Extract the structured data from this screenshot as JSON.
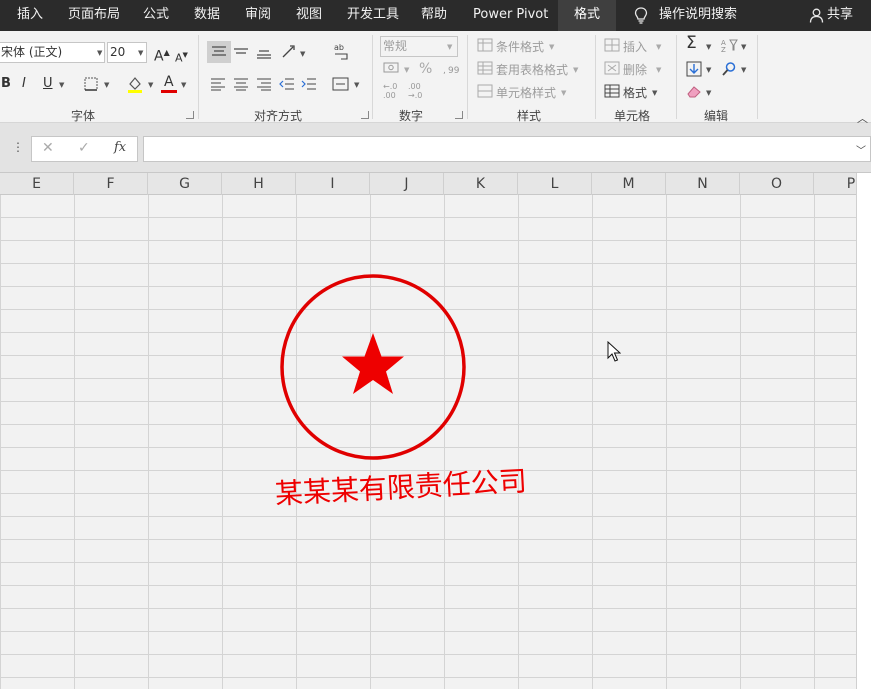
{
  "menu": {
    "tabs": [
      {
        "label": "插入"
      },
      {
        "label": "页面布局"
      },
      {
        "label": "公式"
      },
      {
        "label": "数据"
      },
      {
        "label": "审阅"
      },
      {
        "label": "视图"
      },
      {
        "label": "开发工具"
      },
      {
        "label": "帮助"
      },
      {
        "label": "Power Pivot"
      },
      {
        "label": "格式",
        "active": true
      }
    ],
    "tell_me": "操作说明搜索",
    "share": "共享"
  },
  "ribbon": {
    "font": {
      "group_label": "字体",
      "name": "宋体 (正文)",
      "size": "20",
      "grow": "A",
      "shrink": "A",
      "bold": "B",
      "italic": "I",
      "underline": "U",
      "font_color_letter": "A"
    },
    "alignment": {
      "group_label": "对齐方式"
    },
    "number": {
      "group_label": "数字",
      "format": "常规",
      "percent": "%",
      "inc_top": "←.0",
      "inc_bottom": ".00",
      "dec_top": ".00",
      "dec_bottom": "→.0"
    },
    "styles": {
      "group_label": "样式",
      "conditional": "条件格式",
      "table": "套用表格格式",
      "cell": "单元格样式"
    },
    "cells": {
      "group_label": "单元格",
      "insert": "插入",
      "delete": "删除",
      "format": "格式"
    },
    "editing": {
      "group_label": "编辑",
      "sum": "Σ"
    }
  },
  "formula_bar": {
    "cancel": "✕",
    "enter": "✓",
    "fx": "fx",
    "value": ""
  },
  "columns": [
    "E",
    "F",
    "G",
    "H",
    "I",
    "J",
    "K",
    "L",
    "M",
    "N",
    "O",
    "P"
  ],
  "seal": {
    "company": "某某某有限责任公司",
    "color": "#ee0000"
  },
  "colors": {
    "menu_bg": "#2b2b2b",
    "seal_red": "#ee0000"
  }
}
